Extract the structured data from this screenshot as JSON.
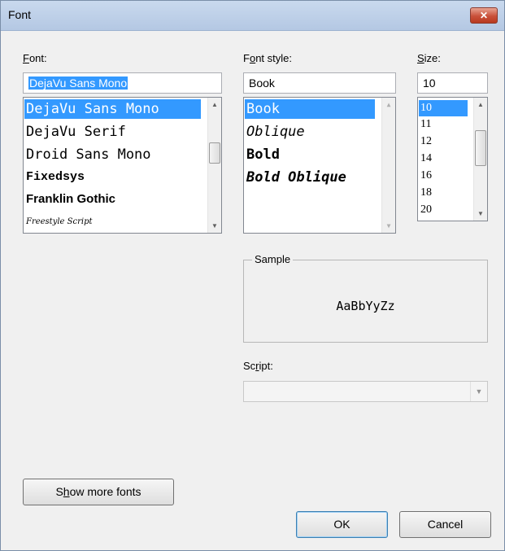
{
  "window": {
    "title": "Font",
    "close_glyph": "✕"
  },
  "font": {
    "label_u": "F",
    "label_rest": "ont:",
    "value": "DejaVu Sans Mono",
    "items": [
      "DejaVu Sans Mono",
      "DejaVu Serif",
      "Droid Sans Mono",
      "Fixedsys",
      "Franklin Gothic",
      "Freestyle Script"
    ],
    "selected": "DejaVu Sans Mono"
  },
  "style": {
    "label_pre": "F",
    "label_u": "o",
    "label_rest": "nt style:",
    "value": "Book",
    "items": [
      "Book",
      "Oblique",
      "Bold",
      "Bold Oblique"
    ],
    "selected": "Book"
  },
  "size": {
    "label_u": "S",
    "label_rest": "ize:",
    "value": "10",
    "items": [
      "10",
      "11",
      "12",
      "14",
      "16",
      "18",
      "20"
    ],
    "selected": "10"
  },
  "sample": {
    "title": "Sample",
    "text": "AaBbYyZz"
  },
  "script": {
    "label_pre": "Sc",
    "label_u": "r",
    "label_rest": "ipt:",
    "value": ""
  },
  "buttons": {
    "more_pre": "S",
    "more_u": "h",
    "more_rest": "ow more fonts",
    "ok": "OK",
    "cancel": "Cancel"
  },
  "icons": {
    "scroll_up": "up-arrow-icon",
    "scroll_down": "down-arrow-icon",
    "combo": "chevron-down-icon",
    "close": "close-icon"
  },
  "colors": {
    "selection": "#3399ff",
    "close_button": "#c9503a",
    "titlebar": "#c9d9ee"
  }
}
